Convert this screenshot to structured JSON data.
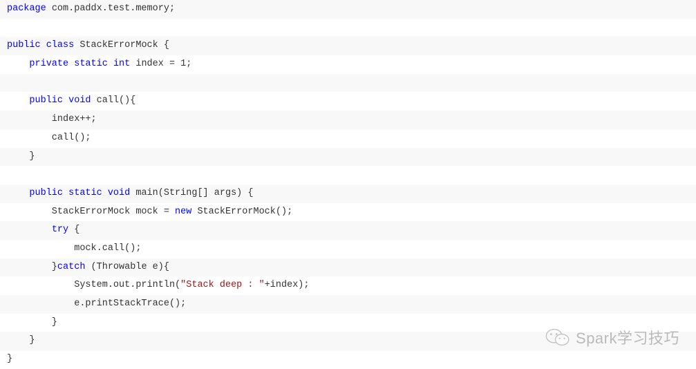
{
  "code": {
    "lines": [
      [
        {
          "t": "package ",
          "c": "kw"
        },
        {
          "t": "com.paddx.test.memory;",
          "c": "txt"
        }
      ],
      [],
      [
        {
          "t": "public class ",
          "c": "kw"
        },
        {
          "t": "StackErrorMock {",
          "c": "txt"
        }
      ],
      [
        {
          "t": "    ",
          "c": "txt"
        },
        {
          "t": "private static ",
          "c": "kw"
        },
        {
          "t": "int ",
          "c": "type"
        },
        {
          "t": "index = 1;",
          "c": "txt"
        }
      ],
      [],
      [
        {
          "t": "    ",
          "c": "txt"
        },
        {
          "t": "public void ",
          "c": "kw"
        },
        {
          "t": "call(){",
          "c": "txt"
        }
      ],
      [
        {
          "t": "        index++;",
          "c": "txt"
        }
      ],
      [
        {
          "t": "        call();",
          "c": "txt"
        }
      ],
      [
        {
          "t": "    }",
          "c": "txt"
        }
      ],
      [],
      [
        {
          "t": "    ",
          "c": "txt"
        },
        {
          "t": "public static void ",
          "c": "kw"
        },
        {
          "t": "main(String[] args) {",
          "c": "txt"
        }
      ],
      [
        {
          "t": "        StackErrorMock mock = ",
          "c": "txt"
        },
        {
          "t": "new ",
          "c": "kw"
        },
        {
          "t": "StackErrorMock();",
          "c": "txt"
        }
      ],
      [
        {
          "t": "        ",
          "c": "txt"
        },
        {
          "t": "try ",
          "c": "kw"
        },
        {
          "t": "{",
          "c": "txt"
        }
      ],
      [
        {
          "t": "            mock.call();",
          "c": "txt"
        }
      ],
      [
        {
          "t": "        }",
          "c": "txt"
        },
        {
          "t": "catch ",
          "c": "kw"
        },
        {
          "t": "(Throwable e){",
          "c": "txt"
        }
      ],
      [
        {
          "t": "            System.out.println(",
          "c": "txt"
        },
        {
          "t": "\"Stack deep : \"",
          "c": "str"
        },
        {
          "t": "+index);",
          "c": "txt"
        }
      ],
      [
        {
          "t": "            e.printStackTrace();",
          "c": "txt"
        }
      ],
      [
        {
          "t": "        }",
          "c": "txt"
        }
      ],
      [
        {
          "t": "    }",
          "c": "txt"
        }
      ],
      [
        {
          "t": "}",
          "c": "txt"
        }
      ]
    ]
  },
  "watermark": {
    "text": "Spark学习技巧"
  }
}
